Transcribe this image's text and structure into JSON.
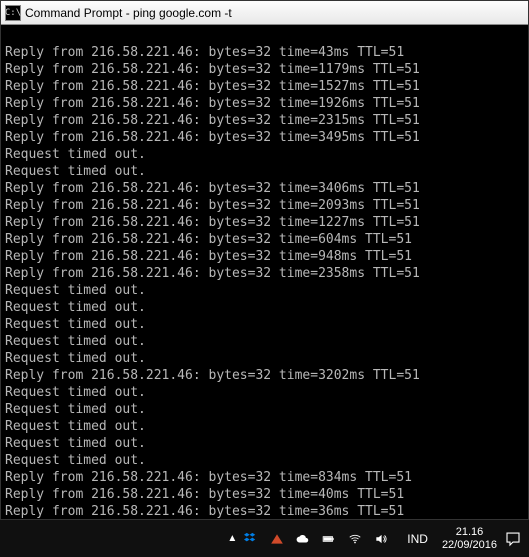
{
  "window": {
    "title": "Command Prompt - ping  google.com -t",
    "icon_label": "C:\\"
  },
  "terminal": {
    "ip": "216.58.221.46",
    "bytes": "32",
    "ttl": "51",
    "lines": [
      {
        "type": "blank"
      },
      {
        "type": "reply",
        "time": "43ms"
      },
      {
        "type": "reply",
        "time": "1179ms"
      },
      {
        "type": "reply",
        "time": "1527ms"
      },
      {
        "type": "reply",
        "time": "1926ms"
      },
      {
        "type": "reply",
        "time": "2315ms"
      },
      {
        "type": "reply",
        "time": "3495ms"
      },
      {
        "type": "timeout"
      },
      {
        "type": "timeout"
      },
      {
        "type": "reply",
        "time": "3406ms"
      },
      {
        "type": "reply",
        "time": "2093ms"
      },
      {
        "type": "reply",
        "time": "1227ms"
      },
      {
        "type": "reply",
        "time": "604ms"
      },
      {
        "type": "reply",
        "time": "948ms"
      },
      {
        "type": "reply",
        "time": "2358ms"
      },
      {
        "type": "timeout"
      },
      {
        "type": "timeout"
      },
      {
        "type": "timeout"
      },
      {
        "type": "timeout"
      },
      {
        "type": "timeout"
      },
      {
        "type": "reply",
        "time": "3202ms"
      },
      {
        "type": "timeout"
      },
      {
        "type": "timeout"
      },
      {
        "type": "timeout"
      },
      {
        "type": "timeout"
      },
      {
        "type": "timeout"
      },
      {
        "type": "reply",
        "time": "834ms"
      },
      {
        "type": "reply",
        "time": "40ms"
      },
      {
        "type": "reply",
        "time": "36ms"
      }
    ],
    "timeout_text": "Request timed out.",
    "reply_prefix": "Reply from ",
    "reply_bytes_label": ": bytes=",
    "reply_time_label": " time=",
    "reply_ttl_label": " TTL="
  },
  "taskbar": {
    "language": "IND",
    "time": "21.16",
    "date": "22/09/2016"
  }
}
